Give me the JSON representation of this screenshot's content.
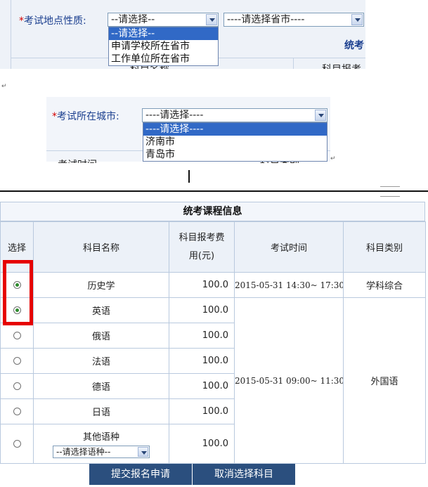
{
  "top_form": {
    "required_mark": "*",
    "label": "考试地点性质:",
    "select_value": "--请选择--",
    "province_select_value": "----请选择省市----",
    "options": [
      "--请选择--",
      "申请学校所在省市",
      "工作单位所在省市"
    ],
    "partial_header": "统考",
    "partial_col": "科目报考"
  },
  "mid_form": {
    "required_mark": "*",
    "label": "考试所在城市:",
    "select_value": "----请选择----",
    "options": [
      "----请选择----",
      "济南市",
      "青岛市"
    ],
    "partial_left": "考试时间",
    "partial_right": "科目类别"
  },
  "table": {
    "title": "统考课程信息",
    "headers": {
      "select": "选择",
      "subject": "科目名称",
      "fee_line1": "科目报考费",
      "fee_line2": "用(元)",
      "time": "考试时间",
      "category": "科目类别"
    },
    "rows": [
      {
        "subject": "历史学",
        "fee": "100.0",
        "selected": true
      },
      {
        "subject": "英语",
        "fee": "100.0",
        "selected": true
      },
      {
        "subject": "俄语",
        "fee": "100.0",
        "selected": false
      },
      {
        "subject": "法语",
        "fee": "100.0",
        "selected": false
      },
      {
        "subject": "德语",
        "fee": "100.0",
        "selected": false
      },
      {
        "subject": "日语",
        "fee": "100.0",
        "selected": false
      },
      {
        "subject": "其他语种",
        "fee": "100.0",
        "selected": false
      }
    ],
    "time_history": "2015-05-31 14:30~ 17:30",
    "category_history": "学科综合",
    "time_language": "2015-05-31 09:00~ 11:30",
    "category_language": "外国语",
    "language_select_value": "--请选择语种--"
  },
  "buttons": {
    "submit": "提交报名申请",
    "cancel": "取消选择科目"
  },
  "colors": {
    "highlight_box": "#e60000",
    "option_highlight": "#3169c6",
    "button_bg": "#2b4f7e"
  }
}
